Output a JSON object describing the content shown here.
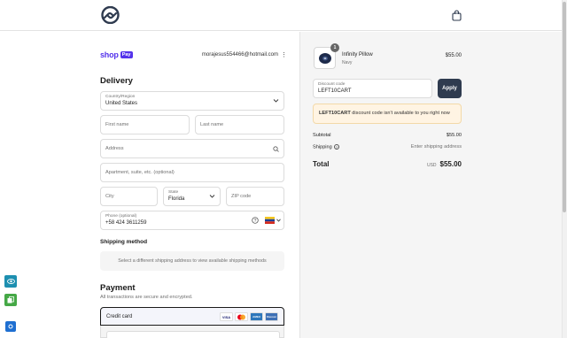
{
  "header": {
    "logo_icon": "store-logo-icon",
    "cart_icon": "shopping-bag-icon"
  },
  "account": {
    "shop_label": "shop",
    "pay_label": "Pay",
    "email": "morajesus554466@hotmail.com",
    "menu_icon": "more-vertical-icon"
  },
  "delivery": {
    "title": "Delivery",
    "country_label": "Country/Region",
    "country_value": "United States",
    "first_name_ph": "First name",
    "last_name_ph": "Last name",
    "address_ph": "Address",
    "apartment_ph": "Apartment, suite, etc. (optional)",
    "city_ph": "City",
    "state_label": "State",
    "state_value": "Florida",
    "zip_ph": "ZIP code",
    "phone_label": "Phone (optional)",
    "phone_value": "+58 424 3611259"
  },
  "shipping": {
    "title": "Shipping method",
    "message": "Select a different shipping address to view available shipping methods"
  },
  "payment": {
    "title": "Payment",
    "subtitle": "All transactions are secure and encrypted.",
    "method": "Credit card",
    "cards": [
      "VISA",
      "Mastercard",
      "AMEX",
      "Discover"
    ]
  },
  "order": {
    "product_name": "Infinity Pillow",
    "product_variant": "Navy",
    "product_price": "$55.00",
    "quantity": "1",
    "discount_label": "Discount code",
    "discount_value": "LEFT10CART",
    "apply_label": "Apply",
    "warning_code": "LEFT10CART",
    "warning_text": " discount code isn't available to you right now",
    "subtotal_label": "Subtotal",
    "subtotal_value": "$55.00",
    "shipping_label": "Shipping",
    "shipping_value": "Enter shipping address",
    "total_label": "Total",
    "total_currency": "USD",
    "total_value": "$55.00"
  },
  "colors": {
    "shop_pay": "#5433eb",
    "apply_button": "#2f3b4f",
    "warning_bg": "#fff4e3"
  }
}
